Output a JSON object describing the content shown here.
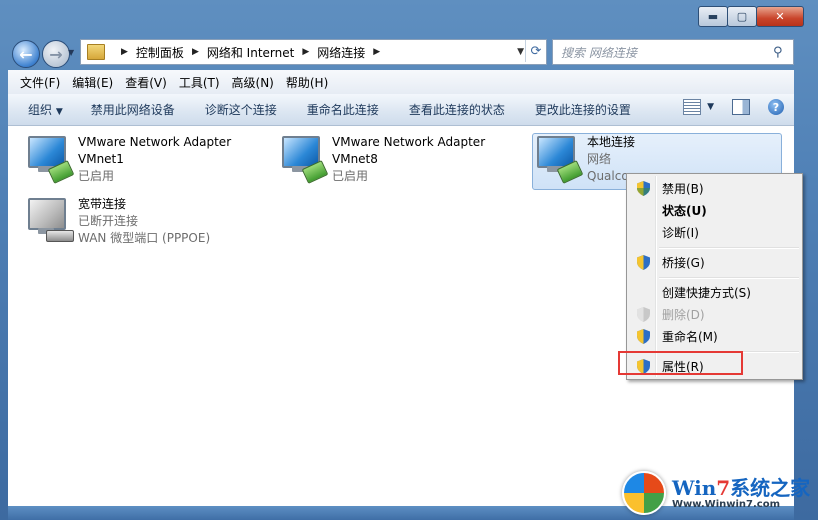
{
  "nav": {
    "address_crumbs": [
      "控制面板",
      "网络和 Internet",
      "网络连接"
    ],
    "search_placeholder": "搜索 网络连接"
  },
  "menubar": [
    "文件(F)",
    "编辑(E)",
    "查看(V)",
    "工具(T)",
    "高级(N)",
    "帮助(H)"
  ],
  "commandbar": {
    "organize": "组织",
    "items": [
      "禁用此网络设备",
      "诊断这个连接",
      "重命名此连接",
      "查看此连接的状态",
      "更改此连接的设置"
    ],
    "help_icon": "?"
  },
  "connections": [
    {
      "name": "VMware Network Adapter",
      "line2": "VMnet1",
      "status": "已启用",
      "icon": "network-adapter-icon"
    },
    {
      "name": "VMware Network Adapter",
      "line2": "VMnet8",
      "status": "已启用",
      "icon": "network-adapter-icon"
    },
    {
      "name": "本地连接",
      "line2": "网络",
      "status": "Qualco",
      "icon": "network-adapter-icon",
      "selected": true
    },
    {
      "name": "宽带连接",
      "line2": "已断开连接",
      "status": "WAN 微型端口 (PPPOE)",
      "icon": "broadband-icon"
    }
  ],
  "context_menu": [
    {
      "label": "禁用(B)",
      "shield": true
    },
    {
      "label": "状态(U)",
      "bold": true
    },
    {
      "label": "诊断(I)"
    },
    {
      "label": "桥接(G)",
      "shield": true
    },
    {
      "label": "创建快捷方式(S)"
    },
    {
      "label": "删除(D)",
      "shield": true,
      "disabled": true
    },
    {
      "label": "重命名(M)",
      "shield": true
    },
    {
      "label": "属性(R)",
      "shield": true,
      "highlighted": true
    }
  ],
  "watermark": {
    "brand_a": "Win",
    "brand_b": "7",
    "brand_c": "系统之家",
    "url": "Www.Winwin7.com"
  },
  "colors": {
    "highlight_border": "#e53935",
    "accent": "#1e395b"
  }
}
